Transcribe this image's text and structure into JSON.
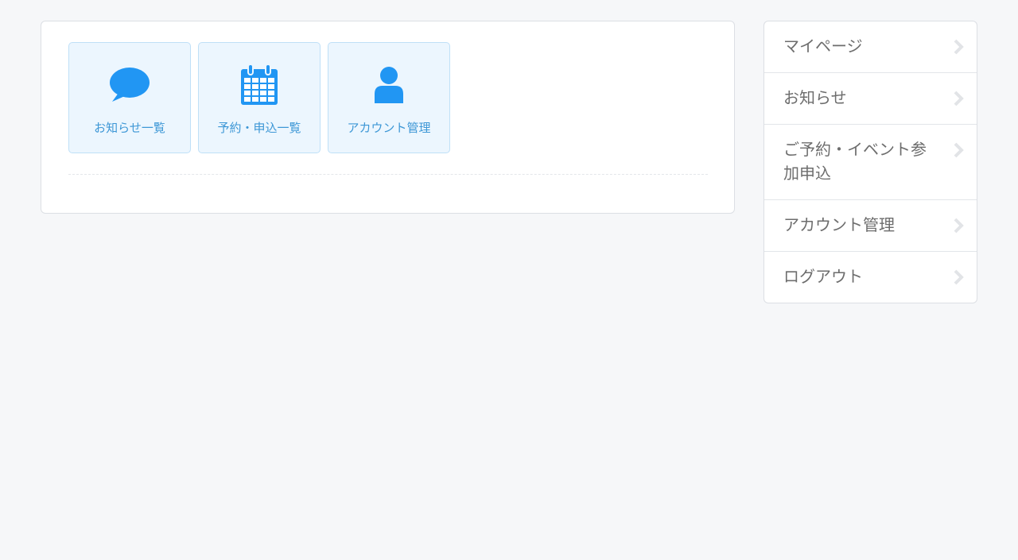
{
  "tiles": [
    {
      "label": "お知らせ一覧",
      "icon": "speech-bubble-icon"
    },
    {
      "label": "予約・申込一覧",
      "icon": "calendar-icon"
    },
    {
      "label": "アカウント管理",
      "icon": "user-icon"
    }
  ],
  "side_menu": {
    "items": [
      {
        "label": "マイページ"
      },
      {
        "label": "お知らせ"
      },
      {
        "label": "ご予約・イベント参加申込"
      },
      {
        "label": "アカウント管理"
      },
      {
        "label": "ログアウト"
      }
    ]
  },
  "colors": {
    "accent": "#2196f3",
    "tile_background": "#ecf6fe",
    "tile_text": "#3d97d6",
    "page_background": "#f6f7f9",
    "menu_text": "#6d6d6d",
    "chevron": "#e2e4e7"
  }
}
